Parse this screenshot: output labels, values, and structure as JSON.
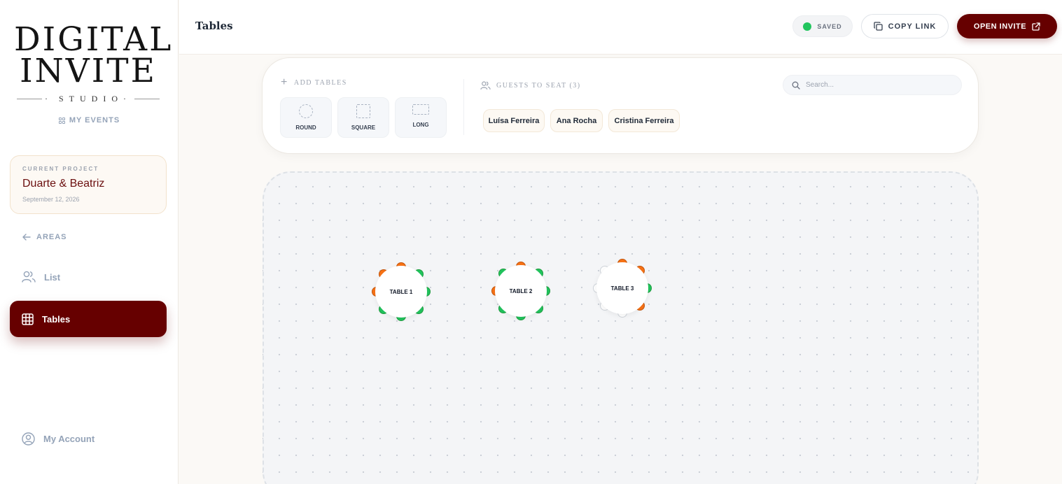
{
  "sidebar": {
    "logo": {
      "line1": "DIGITAL",
      "line2": "INVITE",
      "line3": "STUDIO"
    },
    "my_events": "MY EVENTS",
    "current_project": {
      "label": "CURRENT PROJECT",
      "name": "Duarte & Beatriz",
      "date": "September 12, 2026"
    },
    "back_label": "AREAS",
    "nav": [
      {
        "label": "List",
        "icon": "users-icon"
      },
      {
        "label": "Tables",
        "icon": "grid-table-icon",
        "active": true
      }
    ],
    "account": "My Account"
  },
  "header": {
    "title": "Tables",
    "saved": "SAVED",
    "copy_link": "COPY LINK",
    "open_invite": "OPEN INVITE"
  },
  "toolbar": {
    "add_tables_label": "ADD TABLES",
    "shapes": [
      "ROUND",
      "SQUARE",
      "LONG"
    ],
    "guests_label": "GUESTS TO SEAT (3)",
    "search_placeholder": "Search...",
    "guests": [
      "Luísa Ferreira",
      "Ana Rocha",
      "Cristina Ferreira"
    ]
  },
  "tables": [
    {
      "label": "TABLE 1",
      "seats": [
        "o",
        "g",
        "g",
        "g",
        "g",
        "g",
        "o",
        "o"
      ]
    },
    {
      "label": "TABLE 2",
      "seats": [
        "o",
        "g",
        "g",
        "g",
        "g",
        "g",
        "o",
        "g"
      ]
    },
    {
      "label": "TABLE 3",
      "seats": [
        "o",
        "o",
        "g",
        "o",
        "e",
        "e",
        "e",
        "e"
      ]
    }
  ],
  "colors": {
    "brand": "#660000",
    "seat_assigned": "#22c55e",
    "seat_pending": "#f97316",
    "seat_empty": "#ffffff"
  }
}
